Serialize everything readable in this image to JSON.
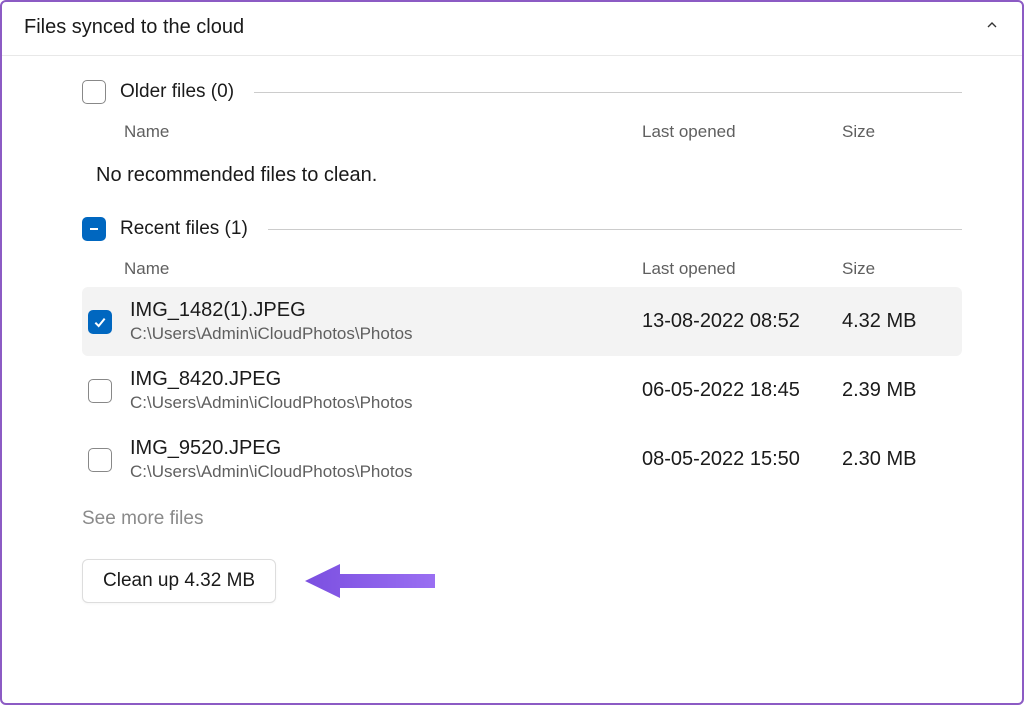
{
  "header": {
    "title": "Files synced to the cloud"
  },
  "older_section": {
    "title": "Older files (0)",
    "columns": {
      "name": "Name",
      "last_opened": "Last opened",
      "size": "Size"
    },
    "empty_message": "No recommended files to clean."
  },
  "recent_section": {
    "title": "Recent files (1)",
    "columns": {
      "name": "Name",
      "last_opened": "Last opened",
      "size": "Size"
    },
    "files": [
      {
        "name": "IMG_1482(1).JPEG",
        "path": "C:\\Users\\Admin\\iCloudPhotos\\Photos",
        "last_opened": "13-08-2022 08:52",
        "size": "4.32 MB",
        "selected": true
      },
      {
        "name": "IMG_8420.JPEG",
        "path": "C:\\Users\\Admin\\iCloudPhotos\\Photos",
        "last_opened": "06-05-2022 18:45",
        "size": "2.39 MB",
        "selected": false
      },
      {
        "name": "IMG_9520.JPEG",
        "path": "C:\\Users\\Admin\\iCloudPhotos\\Photos",
        "last_opened": "08-05-2022 15:50",
        "size": "2.30 MB",
        "selected": false
      }
    ]
  },
  "see_more_label": "See more files",
  "cleanup_label": "Clean up 4.32 MB"
}
